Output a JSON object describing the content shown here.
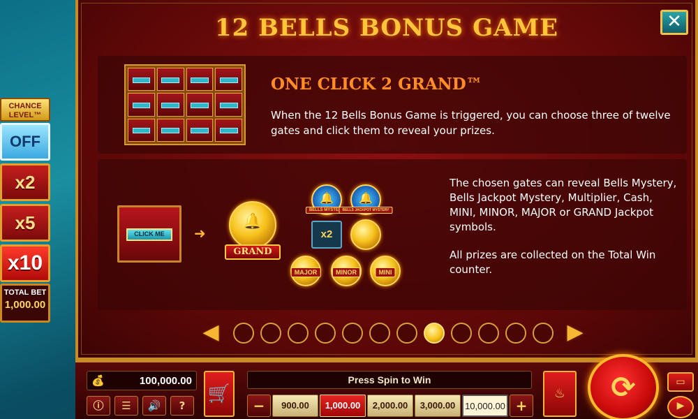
{
  "chance_level": {
    "title": "CHANCE LEVEL™",
    "options": [
      "OFF",
      "x2",
      "x5",
      "x10"
    ],
    "selected": "OFF",
    "total_bet_label": "TOTAL BET",
    "total_bet_value": "1,000.00"
  },
  "info": {
    "title": "12 BELLS BONUS GAME",
    "close_icon": "close-icon",
    "section1": {
      "heading": "ONE CLICK 2 GRAND™",
      "text": "When the 12 Bells Bonus Game is triggered, you can choose three of twelve gates and click them to reveal your prizes.",
      "gate_count": 12
    },
    "section2": {
      "click_me": "CLICK ME",
      "grand_label": "GRAND",
      "bells_mystery": "BELLS MYSTERY",
      "bells_jackpot_mystery": "BELLS JACKPOT MYSTERY",
      "multiplier": "x2",
      "major": "MAJOR",
      "minor": "MINOR",
      "mini": "MINI",
      "text1": "The chosen gates can reveal Bells Mystery, Bells Jackpot Mystery, Multiplier, Cash, MINI, MINOR, MAJOR or GRAND Jackpot symbols.",
      "text2": "All prizes are collected on the Total Win counter."
    },
    "pagination": {
      "page_count": 12,
      "current_page": 8
    }
  },
  "bottom_bar": {
    "balance": "100,000.00",
    "spin_message": "Press Spin to Win",
    "bets": [
      "900.00",
      "1,000.00",
      "2,000.00",
      "3,000.00",
      "10,000.00"
    ],
    "selected_bet": "1,000.00",
    "minus": "−",
    "plus": "+",
    "buttons": [
      "info",
      "menu",
      "sound",
      "help"
    ],
    "icons": {
      "info": "ⓘ",
      "menu": "☰",
      "sound": "🔊",
      "help": "?",
      "cart": "🛒",
      "money": "💰"
    }
  }
}
